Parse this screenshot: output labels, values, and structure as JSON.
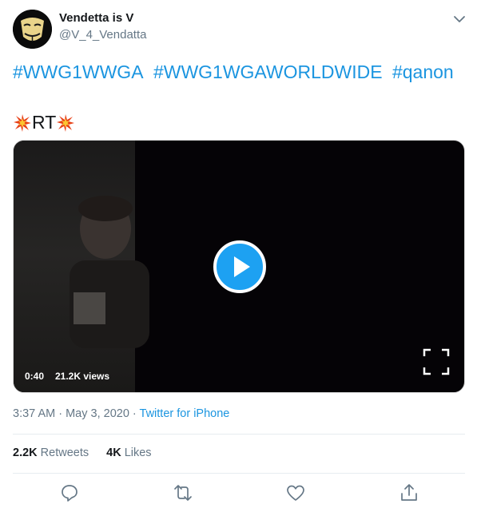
{
  "author": {
    "name": "Vendetta is V",
    "handle": "@V_4_Vendatta"
  },
  "hashtags": [
    "#WWG1WWGA",
    "#WWG1WGAWORLDWIDE",
    "#qanon"
  ],
  "rt_text": "RT",
  "video": {
    "duration": "0:40",
    "views": "21.2K views"
  },
  "meta": {
    "time": "3:37 AM",
    "separator1": " · ",
    "date": "May 3, 2020",
    "separator2": " · ",
    "source": "Twitter for iPhone"
  },
  "stats": {
    "retweets_count": "2.2K",
    "retweets_label": "Retweets",
    "likes_count": "4K",
    "likes_label": "Likes"
  },
  "colors": {
    "link": "#1b95e0",
    "play_button": "#1da1f2",
    "muted_text": "#657786"
  },
  "icons": [
    "chevron-down-icon",
    "explosion-emoji-icon",
    "play-icon",
    "fullscreen-icon",
    "reply-icon",
    "retweet-icon",
    "like-icon",
    "share-icon"
  ]
}
